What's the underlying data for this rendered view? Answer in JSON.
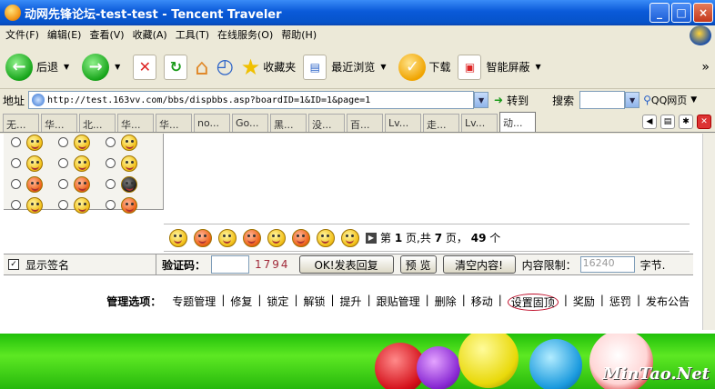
{
  "window": {
    "title": "动网先锋论坛-test-test - Tencent Traveler",
    "min": "_",
    "max": "□",
    "close": "×"
  },
  "menu": [
    "文件(F)",
    "编辑(E)",
    "查看(V)",
    "收藏(A)",
    "工具(T)",
    "在线服务(O)",
    "帮助(H)"
  ],
  "toolbar": {
    "back": "后退",
    "favorites": "收藏夹",
    "recent": "最近浏览",
    "download": "下载",
    "smart_block": "智能屏蔽",
    "more": "»"
  },
  "address": {
    "label": "地址",
    "url": "http://test.163vv.com/bbs/dispbbs.asp?boardID=1&ID=1&page=1",
    "go": "转到",
    "search_label": "搜索",
    "search_engine": "QQ网页"
  },
  "tabs": [
    "无...",
    "华...",
    "北...",
    "华...",
    "华...",
    "no...",
    "Go...",
    "黑...",
    "没...",
    "百...",
    "Lv...",
    "走...",
    "Lv...",
    "动..."
  ],
  "active_tab_index": 13,
  "post": {
    "page_info": {
      "prefix": "第",
      "page": "1",
      "mid": "页,共",
      "total_pages": "7",
      "mid2": "页，",
      "count": "49",
      "suffix": "个"
    },
    "show_signature": "显示签名",
    "captcha_label": "验证码：",
    "captcha_code": "1794",
    "submit": "OK!发表回复",
    "preview": "预 览",
    "clear": "清空内容!",
    "limit_label": "内容限制：",
    "limit_value": "16240",
    "limit_unit": "字节."
  },
  "admin": {
    "label": "管理选项：",
    "links": [
      "专题管理",
      "修复",
      "锁定",
      "解锁",
      "提升",
      "跟贴管理",
      "删除",
      "移动",
      "设置固顶",
      "奖励",
      "惩罚",
      "发布公告"
    ],
    "highlighted_index": 8
  },
  "watermark": "MinTao.Net"
}
